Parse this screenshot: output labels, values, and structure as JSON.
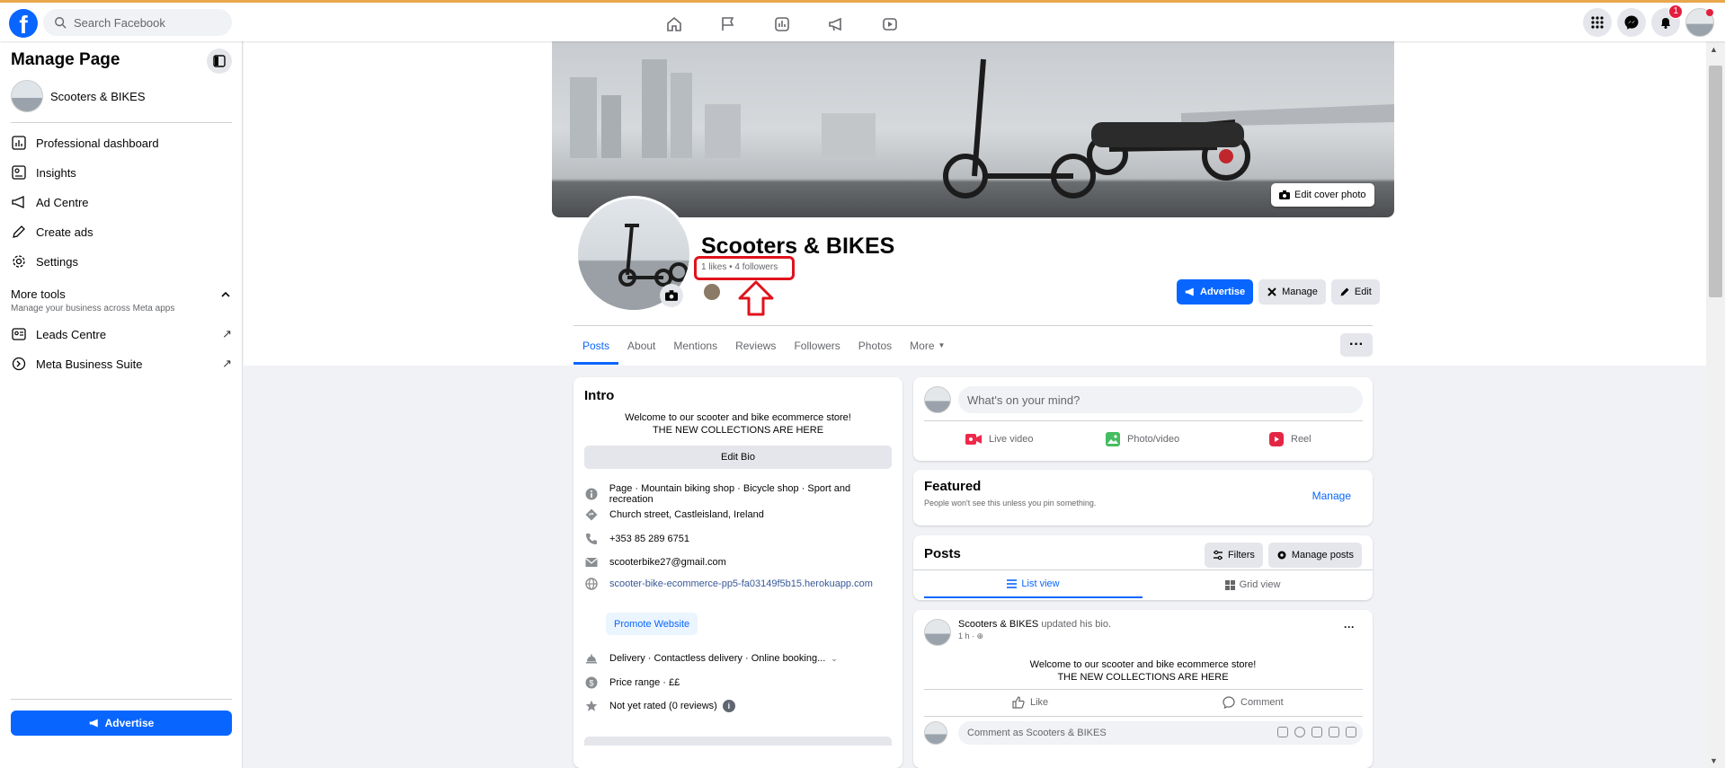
{
  "topbar": {
    "logo": "f",
    "search_placeholder": "Search Facebook",
    "nav_icons": [
      "home-icon",
      "flag-icon",
      "insights-icon",
      "megaphone-icon",
      "video-icon"
    ],
    "right_icons": [
      "menu-grid-icon",
      "messenger-icon",
      "bell-icon",
      "account-avatar"
    ],
    "notification_count": "1",
    "accent_color": "#0866ff"
  },
  "sidebar": {
    "title": "Manage Page",
    "page_name": "Scooters & BIKES",
    "items": [
      {
        "label": "Professional dashboard",
        "icon": "dashboard-icon"
      },
      {
        "label": "Insights",
        "icon": "insights-icon"
      },
      {
        "label": "Ad Centre",
        "icon": "megaphone-icon"
      },
      {
        "label": "Create ads",
        "icon": "pencil-icon"
      },
      {
        "label": "Settings",
        "icon": "gear-icon"
      }
    ],
    "more_tools_title": "More tools",
    "more_tools_subtitle": "Manage your business across Meta apps",
    "tools": [
      {
        "label": "Leads Centre",
        "icon": "leads-icon"
      },
      {
        "label": "Meta Business Suite",
        "icon": "meta-icon"
      }
    ],
    "advertise_label": "Advertise"
  },
  "header": {
    "edit_cover_label": "Edit cover photo",
    "page_name": "Scooters & BIKES",
    "stats": "1 likes • 4 followers",
    "advertise_label": "Advertise",
    "manage_label": "Manage",
    "edit_label": "Edit",
    "tabs": [
      "Posts",
      "About",
      "Mentions",
      "Reviews",
      "Followers",
      "Photos",
      "More"
    ],
    "more_options": "···"
  },
  "intro": {
    "title": "Intro",
    "bio_line1": "Welcome to our scooter and bike ecommerce store!",
    "bio_line2": "THE NEW COLLECTIONS ARE HERE",
    "edit_bio_label": "Edit Bio",
    "category": "Page · Mountain biking shop · Bicycle shop · Sport and recreation",
    "address": "Church street, Castleisland, Ireland",
    "phone": "+353 85 289 6751",
    "email": "scooterbike27@gmail.com",
    "website": "scooter-bike-ecommerce-pp5-fa03149f5b15.herokuapp.com",
    "promote_label": "Promote Website",
    "services": "Delivery · Contactless delivery · Online booking...",
    "price_range": "Price range · ££",
    "rating": "Not yet rated (0 reviews)"
  },
  "composer": {
    "placeholder": "What's on your mind?",
    "actions": [
      "Live video",
      "Photo/video",
      "Reel"
    ]
  },
  "featured": {
    "title": "Featured",
    "subtitle": "People won't see this unless you pin something.",
    "manage_label": "Manage"
  },
  "posts_section": {
    "title": "Posts",
    "filters_label": "Filters",
    "manage_posts_label": "Manage posts",
    "list_view_label": "List view",
    "grid_view_label": "Grid view"
  },
  "post": {
    "author": "Scooters & BIKES",
    "action": "updated his bio.",
    "time": "1 h ·",
    "text_line1": "Welcome to our scooter and bike ecommerce store!",
    "text_line2": "THE NEW COLLECTIONS ARE HERE",
    "like_label": "Like",
    "comment_label": "Comment",
    "comment_placeholder": "Comment as Scooters & BIKES"
  }
}
